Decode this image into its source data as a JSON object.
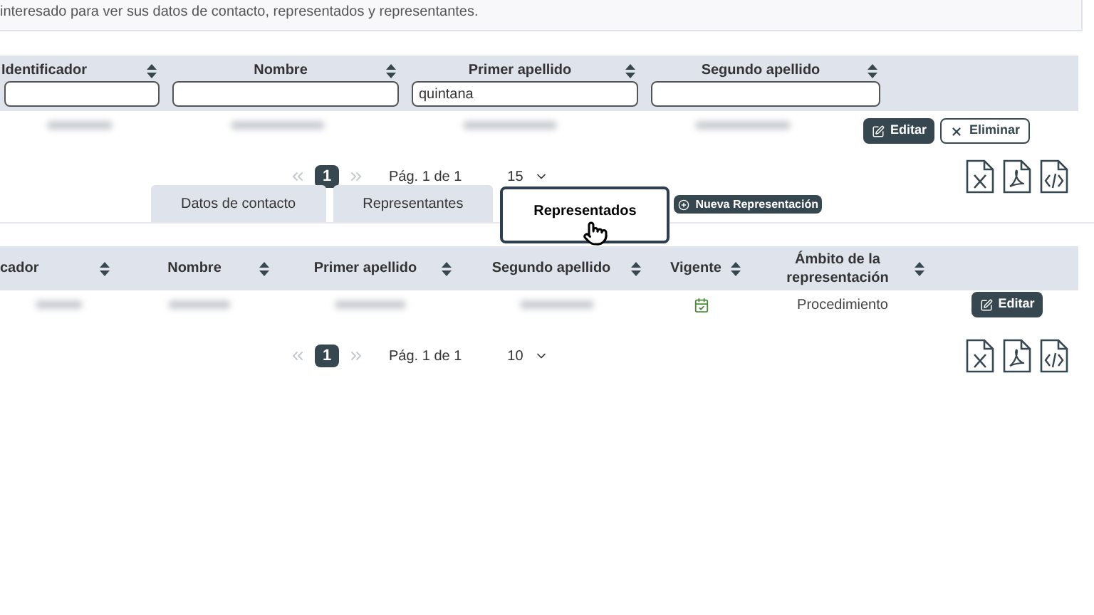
{
  "info_text": "interesado para ver sus datos de contacto, representados y representantes.",
  "top_table": {
    "columns": [
      {
        "label": "Identificador"
      },
      {
        "label": "Nombre"
      },
      {
        "label": "Primer apellido",
        "filter": "quintana"
      },
      {
        "label": "Segundo apellido"
      }
    ],
    "rows": [
      {
        "cells": [
          {
            "kind": "blurred"
          },
          {
            "kind": "blurred"
          },
          {
            "kind": "blurred"
          },
          {
            "kind": "blurred"
          }
        ],
        "actions": [
          {
            "kind": "edit",
            "label": "Editar"
          },
          {
            "kind": "delete",
            "label": "Eliminar"
          }
        ]
      }
    ],
    "pagination": {
      "page": "1",
      "info": "Pág. 1 de 1",
      "page_size": "15"
    }
  },
  "tabs": [
    {
      "label": "Datos de contacto",
      "selected": false
    },
    {
      "label": "Representantes",
      "selected": false
    },
    {
      "label": "Representados",
      "selected": true
    }
  ],
  "new_button": "Nueva Representación",
  "bottom_table": {
    "columns": [
      "cador",
      "Nombre",
      "Primer apellido",
      "Segundo apellido",
      "Vigente",
      "Ámbito de la representación"
    ],
    "rows": [
      {
        "cells": [
          {
            "kind": "blurred"
          },
          {
            "kind": "blurred"
          },
          {
            "kind": "blurred"
          },
          {
            "kind": "blurred"
          },
          {
            "kind": "calendar"
          },
          {
            "kind": "text",
            "text": "Procedimiento"
          }
        ],
        "actions": [
          {
            "kind": "edit",
            "label": "Editar"
          }
        ]
      }
    ],
    "pagination": {
      "page": "1",
      "info": "Pág. 1 de 1",
      "page_size": "10"
    }
  }
}
